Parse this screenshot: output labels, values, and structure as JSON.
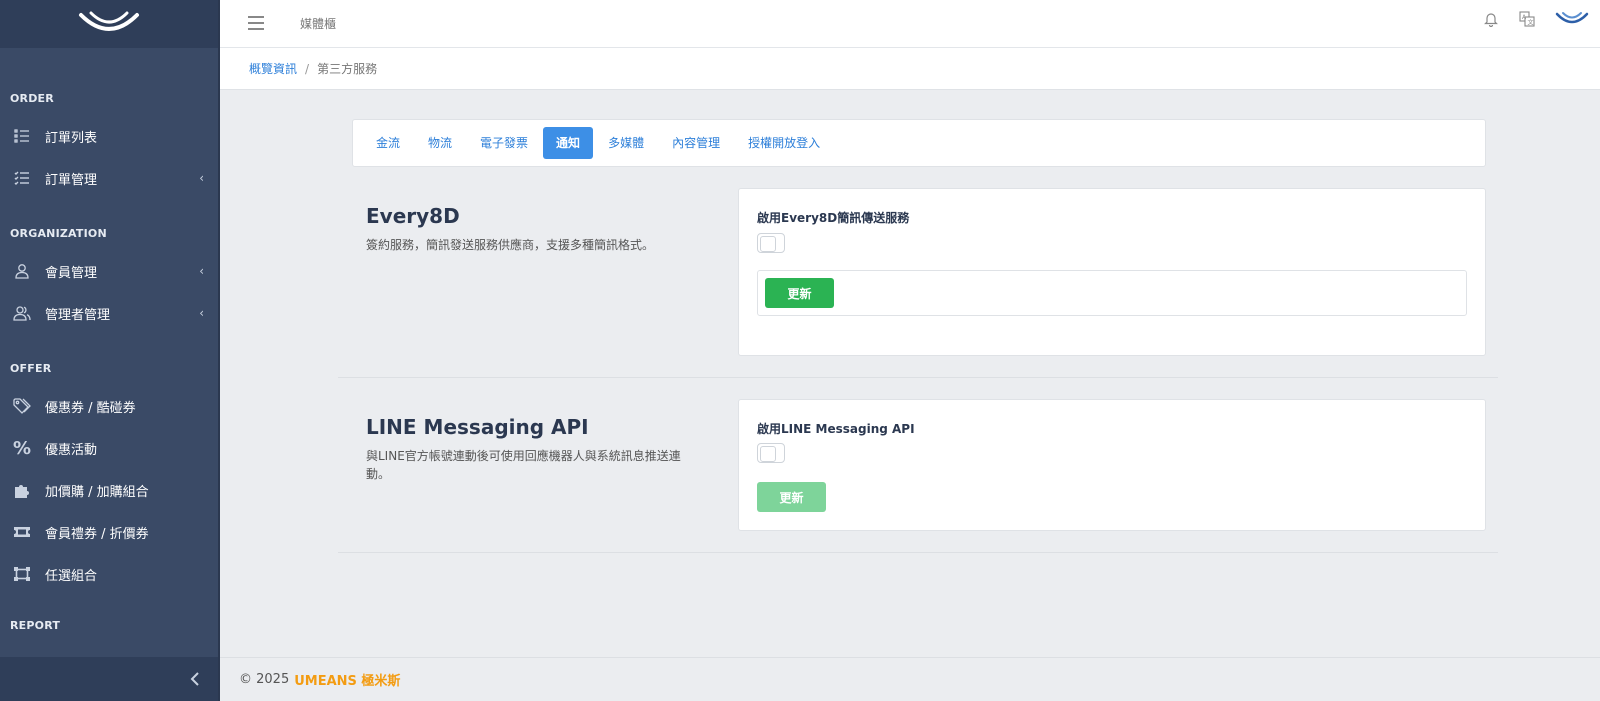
{
  "topbar": {
    "title": "媒體櫃"
  },
  "breadcrumb": {
    "home": "概覽資訊",
    "separator": "/",
    "current": "第三方服務"
  },
  "sidebar": {
    "sections": [
      {
        "label": "ORDER"
      },
      {
        "label": "ORGANIZATION"
      },
      {
        "label": "OFFER"
      },
      {
        "label": "REPORT"
      }
    ],
    "items": [
      {
        "label": "訂單列表",
        "icon": "list-icon"
      },
      {
        "label": "訂單管理",
        "icon": "checklist-icon",
        "expandable": true
      },
      {
        "label": "會員管理",
        "icon": "user-icon",
        "expandable": true
      },
      {
        "label": "管理者管理",
        "icon": "users-icon",
        "expandable": true
      },
      {
        "label": "優惠券 / 酷碰券",
        "icon": "tag-icon"
      },
      {
        "label": "優惠活動",
        "icon": "percent-icon"
      },
      {
        "label": "加價購 / 加購組合",
        "icon": "puzzle-icon"
      },
      {
        "label": "會員禮券 / 折價券",
        "icon": "ticket-icon"
      },
      {
        "label": "任選組合",
        "icon": "crop-icon"
      }
    ]
  },
  "tabs": [
    {
      "label": "金流",
      "active": false
    },
    {
      "label": "物流",
      "active": false
    },
    {
      "label": "電子發票",
      "active": false
    },
    {
      "label": "通知",
      "active": true
    },
    {
      "label": "多媒體",
      "active": false
    },
    {
      "label": "內容管理",
      "active": false
    },
    {
      "label": "授權開放登入",
      "active": false
    }
  ],
  "services": [
    {
      "title": "Every8D",
      "description": "簽約服務，簡訊發送服務供應商，支援多種簡訊格式。",
      "toggle_label": "啟用Every8D簡訊傳送服務",
      "enabled": false,
      "update_label": "更新"
    },
    {
      "title": "LINE Messaging API",
      "description": "與LINE官方帳號連動後可使用回應機器人與系統訊息推送連動。",
      "toggle_label": "啟用LINE Messaging API",
      "enabled": false,
      "update_label": "更新"
    }
  ],
  "footer": {
    "copyright": "© 2025",
    "brand": "UMEANS 極米斯"
  },
  "colors": {
    "sidebar": "#3a4a66",
    "accent": "#3d8fe6",
    "link": "#2d7fd9",
    "success": "#2bb353",
    "brand": "#f39c12"
  }
}
